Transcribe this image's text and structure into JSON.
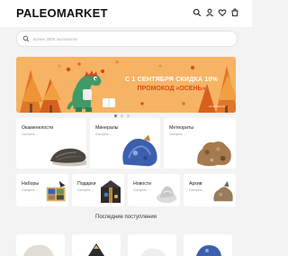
{
  "header": {
    "logo": "PALEOMARKET",
    "icons": [
      "search-icon",
      "user-icon",
      "heart-icon",
      "cart-icon"
    ]
  },
  "search": {
    "placeholder": "Более 3000 экспонатов"
  },
  "banner": {
    "title": "С 1 СЕНТЯБРЯ СКИДКА 10%",
    "promo": "ПРОМОКОД «ОСЕНЬ»",
    "watermark": "PALEOMARKET",
    "colors": {
      "background": "#f6b363",
      "promo": "#d94b12"
    },
    "slides": 3,
    "active_slide": 1
  },
  "categories": [
    {
      "name": "Окаменелости",
      "sub": "Смотреть →"
    },
    {
      "name": "Минералы",
      "sub": "Смотреть →"
    },
    {
      "name": "Метеориты",
      "sub": "Смотреть →"
    },
    {
      "name": "Наборы",
      "sub": "Смотреть →"
    },
    {
      "name": "Подарки",
      "sub": "Смотреть →"
    },
    {
      "name": "Новости",
      "sub": "Смотреть →"
    },
    {
      "name": "Архив",
      "sub": "Смотреть →"
    }
  ],
  "latest": {
    "title": "Последние поступления"
  }
}
